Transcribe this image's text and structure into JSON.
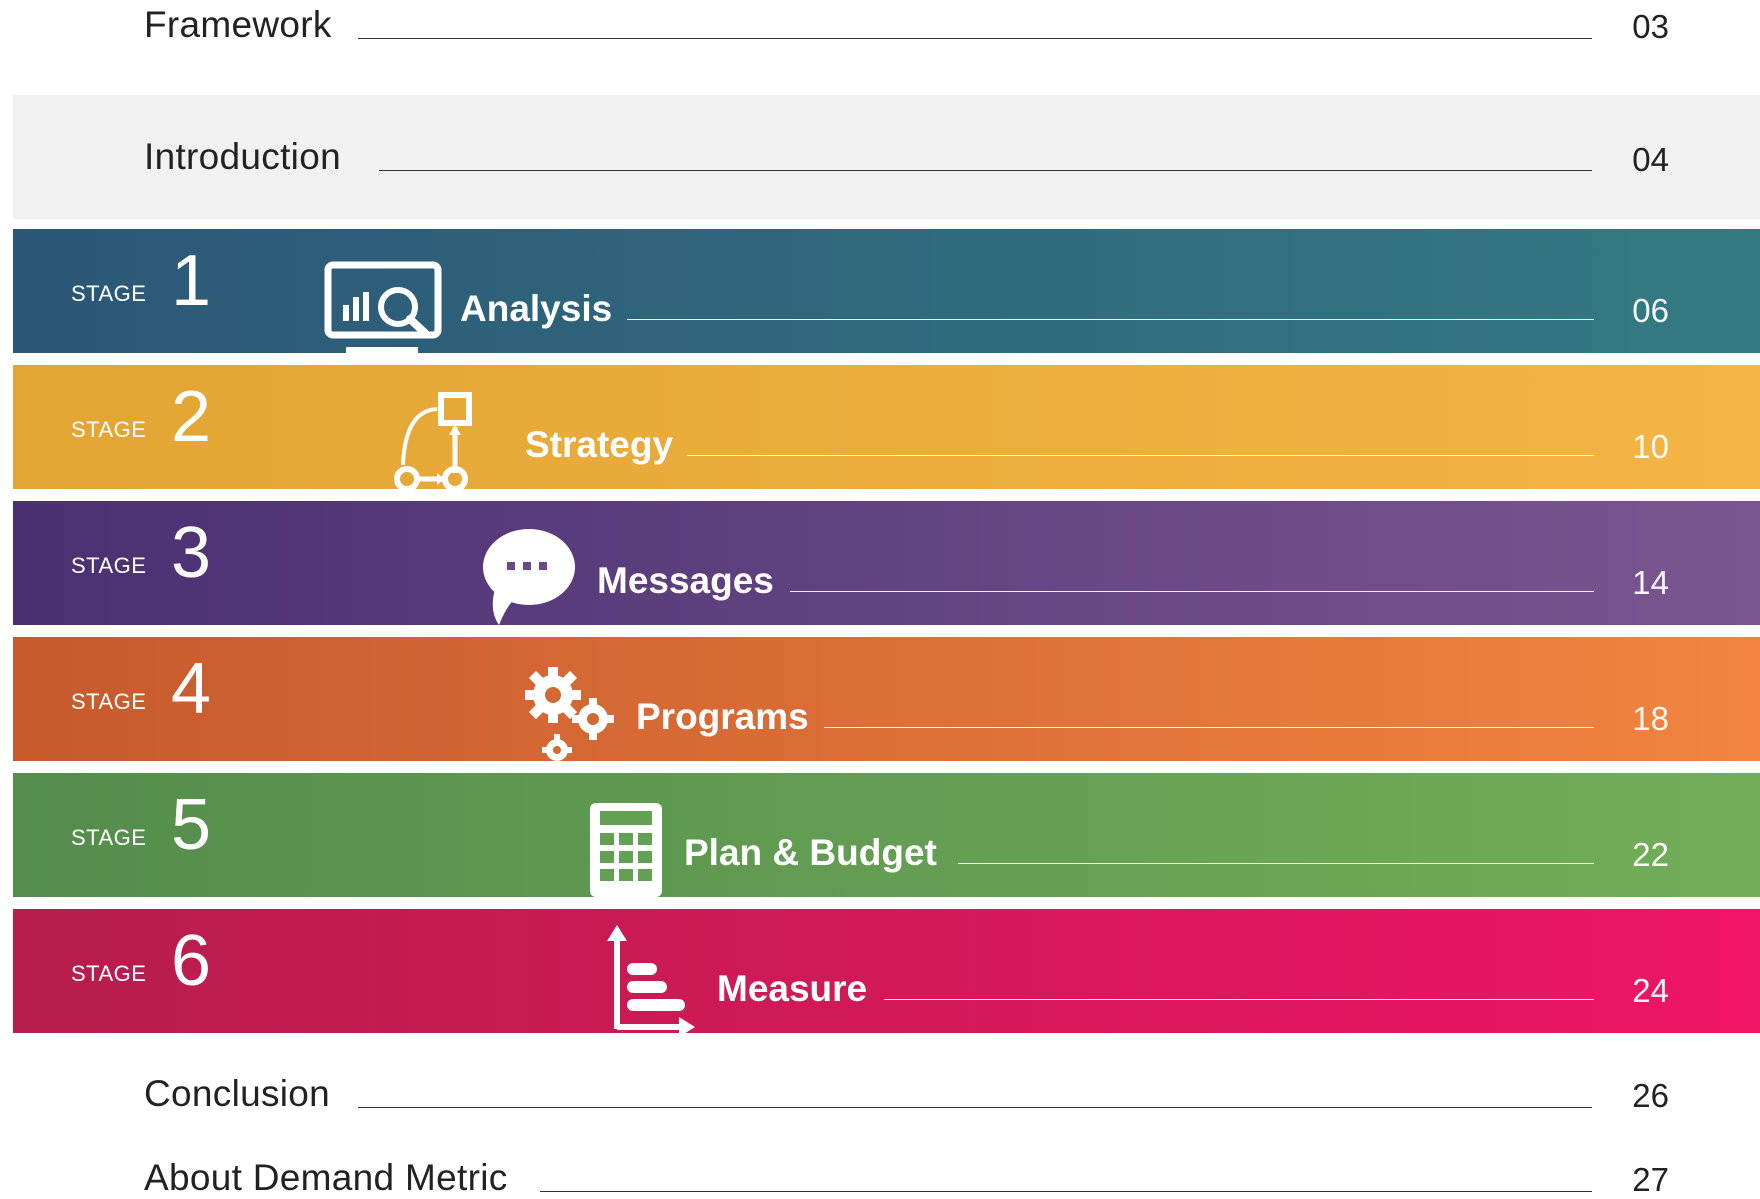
{
  "toc": {
    "framework": {
      "label": "Framework",
      "page": "03"
    },
    "introduction": {
      "label": "Introduction",
      "page": "04"
    },
    "conclusion": {
      "label": "Conclusion",
      "page": "26"
    },
    "about": {
      "label": "About Demand Metric",
      "page": "27"
    }
  },
  "stage_word": "STAGE",
  "stages": [
    {
      "number": "1",
      "title": "Analysis",
      "page": "06",
      "icon": "monitor-chart-magnifier-icon",
      "color_start": "#2c5777",
      "color_end": "#347a82"
    },
    {
      "number": "2",
      "title": "Strategy",
      "page": "10",
      "icon": "flow-diagram-icon",
      "color_start": "#e2a532",
      "color_end": "#f4b446"
    },
    {
      "number": "3",
      "title": "Messages",
      "page": "14",
      "icon": "speech-bubble-icon",
      "color_start": "#4a3072",
      "color_end": "#7a5690"
    },
    {
      "number": "4",
      "title": "Programs",
      "page": "18",
      "icon": "gears-icon",
      "color_start": "#c65a2d",
      "color_end": "#f28440"
    },
    {
      "number": "5",
      "title": "Plan & Budget",
      "page": "22",
      "icon": "calculator-icon",
      "color_start": "#548d4c",
      "color_end": "#72ae58"
    },
    {
      "number": "6",
      "title": "Measure",
      "page": "24",
      "icon": "bar-chart-axes-icon",
      "color_start": "#b61d4c",
      "color_end": "#ee1564"
    }
  ]
}
